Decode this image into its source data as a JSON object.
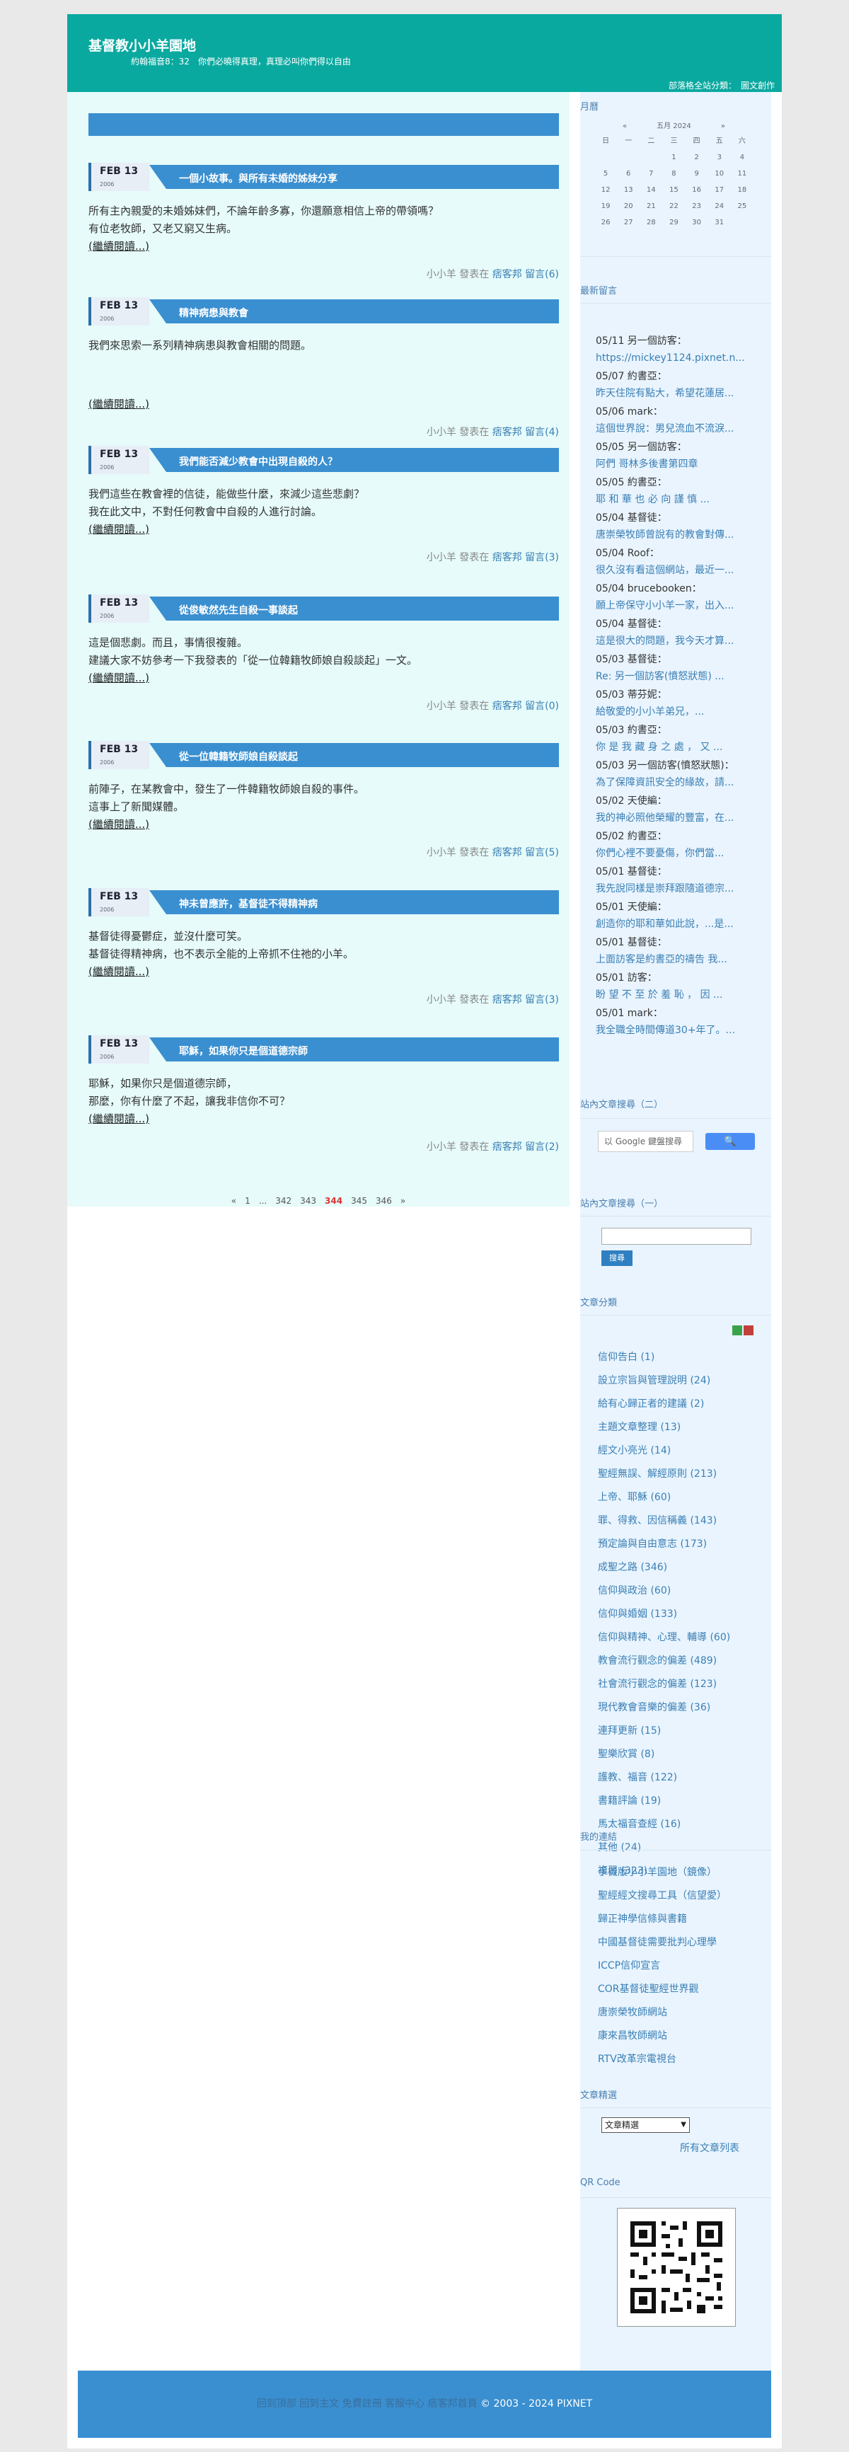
{
  "header": {
    "title": "基督教小小羊園地",
    "desc": "約翰福音8：32　你們必曉得真理，真理必叫你們得以自由",
    "links": [
      "部落格全站分類：",
      "圖文創作"
    ]
  },
  "articles": [
    {
      "date": "FEB 13",
      "year": "2006",
      "title": "一個小故事。與所有未婚的姊妹分享",
      "body": [
        "所有主內親愛的未婚姊妹們，不論年齡多寡，你還願意相信上帝的帶領嗎？",
        "有位老牧師，又老又窮又生病。"
      ],
      "more": "(繼續閱讀...)",
      "footer_pre": "小小羊 發表在 ",
      "footer_link": "痞客邦 留言",
      "footer_count": "(6)"
    },
    {
      "date": "FEB 13",
      "year": "2006",
      "title": "精神病患與教會",
      "body": [
        "我們來思索一系列精神病患與教會相關的問題。"
      ],
      "more": "(繼續閱讀...)",
      "footer_pre": "小小羊 發表在 ",
      "footer_link": "痞客邦 留言",
      "footer_count": "(4)"
    },
    {
      "date": "FEB 13",
      "year": "2006",
      "title": "我們能否減少教會中出現自殺的人？",
      "body": [
        "我們這些在教會裡的信徒，能做些什麼，來減少這些悲劇？",
        "我在此文中，不對任何教會中自殺的人進行討論。"
      ],
      "more": "(繼續閱讀...)",
      "footer_pre": "小小羊 發表在 ",
      "footer_link": "痞客邦 留言",
      "footer_count": "(3)"
    },
    {
      "date": "FEB 13",
      "year": "2006",
      "title": "從俊敏然先生自殺一事談起",
      "body": [
        "這是個悲劇。而且，事情很複雜。",
        "建議大家不妨參考一下我發表的「從一位韓籍牧師娘自殺談起」一文。"
      ],
      "more": "(繼續閱讀...)",
      "footer_pre": "小小羊 發表在 ",
      "footer_link": "痞客邦 留言",
      "footer_count": "(0)"
    },
    {
      "date": "FEB 13",
      "year": "2006",
      "title": "從一位韓籍牧師娘自殺談起",
      "body": [
        "前陣子，在某教會中，發生了一件韓籍牧師娘自殺的事件。",
        "這事上了新聞媒體。"
      ],
      "more": "(繼續閱讀...)",
      "footer_pre": "小小羊 發表在 ",
      "footer_link": "痞客邦 留言",
      "footer_count": "(5)"
    },
    {
      "date": "FEB 13",
      "year": "2006",
      "title": "神未曾應許，基督徒不得精神病",
      "body": [
        "基督徒得憂鬱症，並沒什麼可笑。",
        "基督徒得精神病，也不表示全能的上帝抓不住祂的小羊。"
      ],
      "more": "(繼續閱讀...)",
      "footer_pre": "小小羊 發表在 ",
      "footer_link": "痞客邦 留言",
      "footer_count": "(3)"
    },
    {
      "date": "FEB 13",
      "year": "2006",
      "title": "耶穌，如果你只是個道德宗師",
      "body": [
        "耶穌，如果你只是個道德宗師，",
        "那麼，你有什麼了不起，讓我非信你不可？"
      ],
      "more": "(繼續閱讀...)",
      "footer_pre": "小小羊 發表在 ",
      "footer_link": "痞客邦 留言",
      "footer_count": "(2)"
    }
  ],
  "pager": [
    "«",
    "1",
    "...",
    "342",
    "343",
    "344",
    "345",
    "346",
    "»"
  ],
  "pager_current": "344",
  "sidebar": {
    "calendar_heading": "月曆",
    "calendar": {
      "prev": "«",
      "next": "»",
      "month": "五月 2024",
      "weekdays": [
        "日",
        "一",
        "二",
        "三",
        "四",
        "五",
        "六"
      ],
      "days": [
        "",
        "",
        "",
        "1",
        "2",
        "3",
        "4",
        "5",
        "6",
        "7",
        "8",
        "9",
        "10",
        "11",
        "12",
        "13",
        "14",
        "15",
        "16",
        "17",
        "18",
        "19",
        "20",
        "21",
        "22",
        "23",
        "24",
        "25",
        "26",
        "27",
        "28",
        "29",
        "30",
        "31",
        ""
      ]
    },
    "comments_heading": "最新留言",
    "comments": [
      {
        "who": "05/11 另一個訪客：",
        "text": "https://mickey1124.pixnet.n..."
      },
      {
        "who": "05/07 約書亞：",
        "text": "昨天住院有點大，希望花蓮居..."
      },
      {
        "who": "05/06 mark：",
        "text": "這個世界說：男兒流血不流淚..."
      },
      {
        "who": "05/05 另一個訪客：",
        "text": "阿們 哥林多後書第四章"
      },
      {
        "who": "05/05 約書亞：",
        "text": "耶 和 華 也 必 向 謹 慎 ..."
      },
      {
        "who": "05/04 基督徒：",
        "text": "唐崇榮牧師曾說有的教會對傳..."
      },
      {
        "who": "05/04 Roof：",
        "text": "很久沒有看這個網站，最近一..."
      },
      {
        "who": "05/04 brucebooken：",
        "text": "願上帝保守小小羊一家，出入..."
      },
      {
        "who": "05/04 基督徒：",
        "text": "這是很大的問題，我今天才算..."
      },
      {
        "who": "05/03 基督徒：",
        "text": "Re: 另一個訪客(憤怒狀態) ..."
      },
      {
        "who": "05/03 蒂芬妮：",
        "text": "給敬愛的小小羊弟兄，..."
      },
      {
        "who": "05/03 約書亞：",
        "text": "你 是 我 藏 身 之 處 ， 又 ..."
      },
      {
        "who": "05/03 另一個訪客(憤怒狀態)：",
        "text": "為了保障資訊安全的緣故，請..."
      },
      {
        "who": "05/02 天使編：",
        "text": "我的神必照他榮耀的豐富，在..."
      },
      {
        "who": "05/02 約書亞：",
        "text": "你們心裡不要憂傷，你們當..."
      },
      {
        "who": "05/01 基督徒：",
        "text": "我先說同樣是崇拜跟隨道德宗..."
      },
      {
        "who": "05/01 天使編：",
        "text": "創造你的耶和華如此說，...是..."
      },
      {
        "who": "05/01 基督徒：",
        "text": "上面訪客是約書亞的禱告 我..."
      },
      {
        "who": "05/01 訪客：",
        "text": "盼 望 不 至 於 羞 恥 ， 因 ..."
      },
      {
        "who": "05/01 mark：",
        "text": "我全職全時間傳道30+年了。..."
      }
    ],
    "search2_heading": "站內文章搜尋（二）",
    "search2_placeholder": "以 Google 鍵盤搜尋",
    "search2_button": "🔍",
    "search1_heading": "站內文章搜尋（一）",
    "search1_button": "搜尋",
    "categories_heading": "文章分類",
    "categories": [
      "信仰告白 (1)",
      "設立宗旨與管理說明 (24)",
      "給有心歸正者的建議 (2)",
      "主題文章整理 (13)",
      "經文小亮光 (14)",
      "聖經無誤、解經原則 (213)",
      "上帝、耶穌 (60)",
      "罪、得救、因信稱義 (143)",
      "預定論與自由意志 (173)",
      "成聖之路 (346)",
      "信仰與政治 (60)",
      "信仰與婚姻 (133)",
      "信仰與精神、心理、輔導 (60)",
      "教會流行觀念的偏差 (489)",
      "社會流行觀念的偏差 (123)",
      "現代教會音樂的偏差 (36)",
      "連拜更新 (15)",
      "聖樂欣賞 (8)",
      "護教、福音 (122)",
      "書籍評論 (19)",
      "馬太福音查經 (16)",
      "其他 (24)",
      "複習 (323)"
    ],
    "links_heading": "我的連結",
    "links": [
      "手機版小小羊園地（鏡像）",
      "聖經經文搜尋工具（信望愛）",
      "歸正神學信條與書籍",
      "中國基督徒需要批判心理學",
      "ICCP信仰宣言",
      "COR基督徒聖經世界觀",
      "唐崇榮牧師網站",
      "康來昌牧師網站",
      "RTV改革宗電視台"
    ],
    "select_heading": "文章精選",
    "select_value": "文章精選",
    "all_list": "所有文章列表",
    "qr_heading": "QR Code"
  },
  "footer": {
    "links": "回到頂部 回到主文 免費註冊 客服中心 痞客邦首頁",
    "copyright": " © 2003 - 2024 PIXNET"
  },
  "colors": {
    "header": "#0aa9a0",
    "accent": "#3a8fd0",
    "main_bg": "#e6fbfa",
    "sidebar_bg": "#e9f4fe"
  }
}
